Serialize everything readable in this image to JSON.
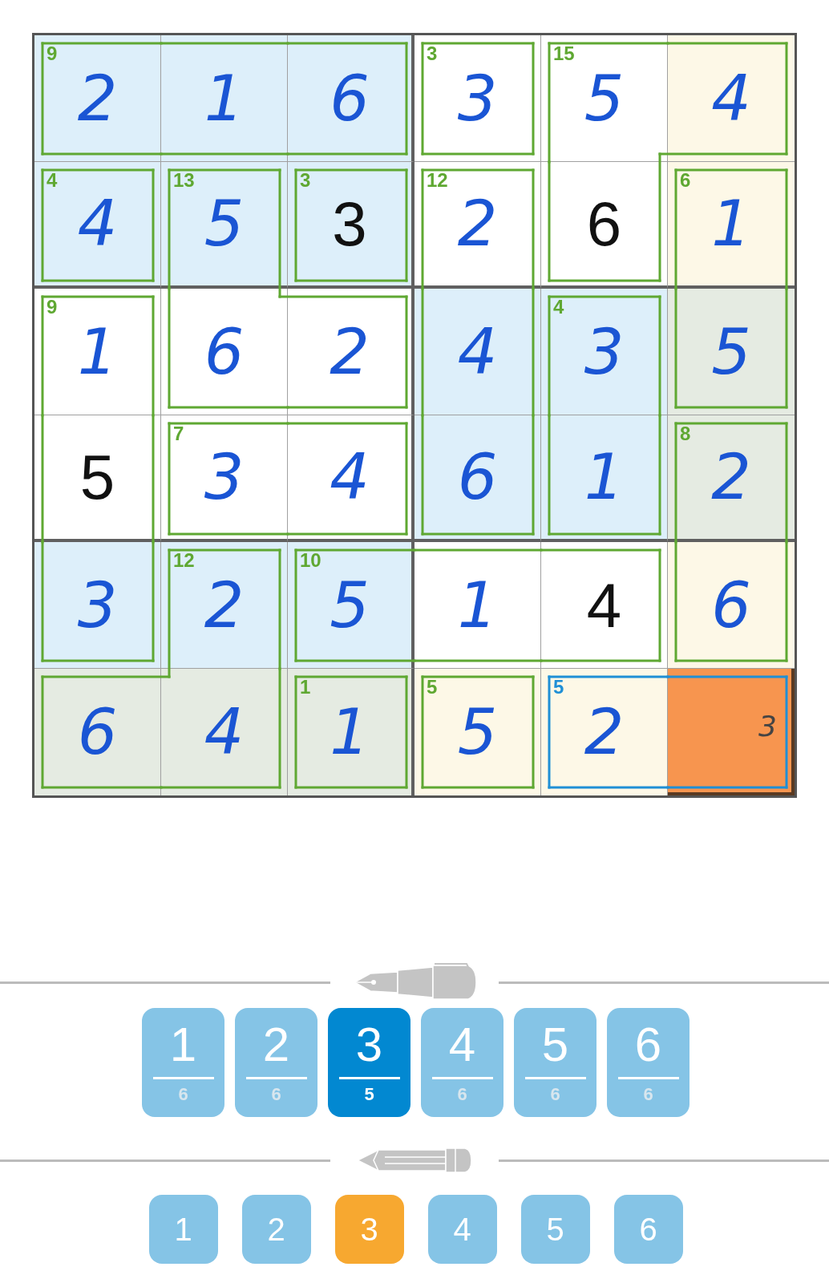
{
  "board": {
    "rows": [
      {
        "cells": [
          {
            "cage_sum": "9",
            "cage_selected": false,
            "value": "2",
            "given": false,
            "color": "#ddeffa",
            "selected": false,
            "cage_right": false,
            "cage_bottom": true
          },
          {
            "value": "1",
            "given": false,
            "color": "#ddeffa",
            "selected": false,
            "cage_right": false,
            "cage_bottom": true
          },
          {
            "value": "6",
            "given": false,
            "color": "#ddeffa",
            "selected": false,
            "cage_right": true,
            "cage_bottom": true
          },
          {
            "cage_sum": "3",
            "cage_selected": false,
            "value": "3",
            "given": false,
            "color": "#ffffff",
            "selected": false,
            "cage_right": true,
            "cage_bottom": true
          },
          {
            "cage_sum": "15",
            "cage_selected": false,
            "value": "5",
            "given": false,
            "color": "#ffffff",
            "selected": false,
            "cage_right": false,
            "cage_bottom": false
          },
          {
            "value": "4",
            "given": false,
            "color": "#fdf8e7",
            "selected": false,
            "cage_bottom": true
          }
        ]
      },
      {
        "cells": [
          {
            "cage_sum": "4",
            "cage_selected": false,
            "value": "4",
            "given": false,
            "color": "#ddeffa",
            "selected": false,
            "cage_right": true,
            "cage_bottom": true
          },
          {
            "cage_sum": "13",
            "cage_selected": false,
            "value": "5",
            "given": false,
            "color": "#ddeffa",
            "selected": false,
            "cage_right": true,
            "cage_bottom": false
          },
          {
            "cage_sum": "3",
            "cage_selected": false,
            "value": "3",
            "given": true,
            "color": "#ddeffa",
            "selected": false,
            "cage_right": true,
            "cage_bottom": true
          },
          {
            "cage_sum": "12",
            "cage_selected": false,
            "value": "2",
            "given": false,
            "color": "#ffffff",
            "selected": false,
            "cage_right": true,
            "cage_bottom": false
          },
          {
            "value": "6",
            "given": true,
            "color": "#ffffff",
            "selected": false,
            "cage_right": true,
            "cage_bottom": true
          },
          {
            "cage_sum": "6",
            "cage_selected": false,
            "value": "1",
            "given": false,
            "color": "#fdf8e7",
            "selected": false,
            "cage_bottom": false
          }
        ]
      },
      {
        "cells": [
          {
            "cage_sum": "9",
            "cage_selected": false,
            "value": "1",
            "given": false,
            "color": "#ffffff",
            "selected": false,
            "cage_right": true,
            "cage_bottom": false
          },
          {
            "value": "6",
            "given": false,
            "color": "#ffffff",
            "selected": false,
            "cage_right": false,
            "cage_bottom": true
          },
          {
            "value": "2",
            "given": false,
            "color": "#ffffff",
            "selected": false,
            "cage_right": true,
            "cage_bottom": true
          },
          {
            "value": "4",
            "given": false,
            "color": "#ddeffa",
            "selected": false,
            "cage_right": true,
            "cage_bottom": false
          },
          {
            "cage_sum": "4",
            "cage_selected": false,
            "value": "3",
            "given": false,
            "color": "#ddeffa",
            "selected": false,
            "cage_right": true,
            "cage_bottom": false
          },
          {
            "value": "5",
            "given": false,
            "color": "#e5ebe2",
            "selected": false,
            "cage_bottom": true
          }
        ]
      },
      {
        "cells": [
          {
            "value": "5",
            "given": true,
            "color": "#ffffff",
            "selected": false,
            "cage_right": true,
            "cage_bottom": false
          },
          {
            "cage_sum": "7",
            "cage_selected": false,
            "value": "3",
            "given": false,
            "color": "#ffffff",
            "selected": false,
            "cage_right": false,
            "cage_bottom": true
          },
          {
            "value": "4",
            "given": false,
            "color": "#ffffff",
            "selected": false,
            "cage_right": true,
            "cage_bottom": true
          },
          {
            "value": "6",
            "given": false,
            "color": "#ddeffa",
            "selected": false,
            "cage_right": true,
            "cage_bottom": true
          },
          {
            "value": "1",
            "given": false,
            "color": "#ddeffa",
            "selected": false,
            "cage_right": true,
            "cage_bottom": true
          },
          {
            "cage_sum": "8",
            "cage_selected": false,
            "value": "2",
            "given": false,
            "color": "#e5ebe2",
            "selected": false,
            "cage_bottom": false
          }
        ]
      },
      {
        "cells": [
          {
            "value": "3",
            "given": false,
            "color": "#ddeffa",
            "selected": false,
            "cage_right": true,
            "cage_bottom": true
          },
          {
            "cage_sum": "12",
            "cage_selected": false,
            "value": "2",
            "given": false,
            "color": "#ddeffa",
            "selected": false,
            "cage_right": true,
            "cage_bottom": false
          },
          {
            "cage_sum": "10",
            "cage_selected": false,
            "value": "5",
            "given": false,
            "color": "#ddeffa",
            "selected": false,
            "cage_right": false,
            "cage_bottom": true
          },
          {
            "value": "1",
            "given": false,
            "color": "#ffffff",
            "selected": false,
            "cage_right": false,
            "cage_bottom": true
          },
          {
            "value": "4",
            "given": true,
            "color": "#ffffff",
            "selected": false,
            "cage_right": true,
            "cage_bottom": true
          },
          {
            "value": "6",
            "given": false,
            "color": "#fdf8e7",
            "selected": false,
            "cage_bottom": true
          }
        ]
      },
      {
        "cells": [
          {
            "value": "6",
            "given": false,
            "color": "#e5ebe2",
            "selected": false,
            "cage_right": false
          },
          {
            "value": "4",
            "given": false,
            "color": "#e5ebe2",
            "selected": false,
            "cage_right": true
          },
          {
            "cage_sum": "1",
            "cage_selected": false,
            "value": "1",
            "given": false,
            "color": "#e5ebe2",
            "selected": false,
            "cage_right": true
          },
          {
            "cage_sum": "5",
            "cage_selected": false,
            "value": "5",
            "given": false,
            "color": "#fdf8e7",
            "selected": false,
            "cage_right": true
          },
          {
            "cage_sum": "5",
            "cage_selected": true,
            "value": "2",
            "given": false,
            "color": "#fdf8e7",
            "selected": false,
            "cage_right": false
          },
          {
            "pencil_marks": [
              "3"
            ],
            "color": "#f7954f",
            "selected": true
          }
        ]
      }
    ]
  },
  "pen_buttons": [
    {
      "digit": "1",
      "count": "6",
      "selected": false
    },
    {
      "digit": "2",
      "count": "6",
      "selected": false
    },
    {
      "digit": "3",
      "count": "5",
      "selected": true
    },
    {
      "digit": "4",
      "count": "6",
      "selected": false
    },
    {
      "digit": "5",
      "count": "6",
      "selected": false
    },
    {
      "digit": "6",
      "count": "6",
      "selected": false
    }
  ],
  "pencil_buttons": [
    {
      "digit": "1",
      "selected": false
    },
    {
      "digit": "2",
      "selected": false
    },
    {
      "digit": "3",
      "selected": true
    },
    {
      "digit": "4",
      "selected": false
    },
    {
      "digit": "5",
      "selected": false
    },
    {
      "digit": "6",
      "selected": false
    }
  ]
}
